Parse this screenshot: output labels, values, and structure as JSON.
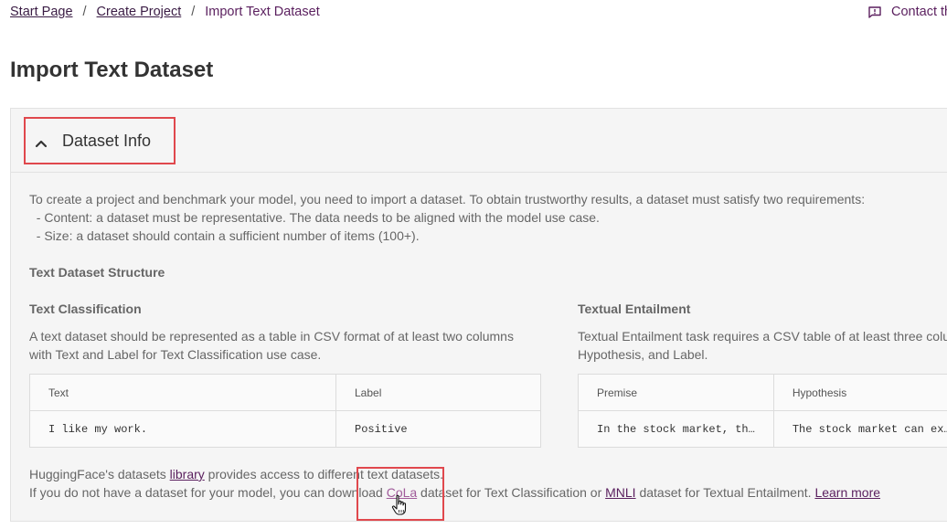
{
  "breadcrumb": {
    "start": "Start Page",
    "separator": "/",
    "create": "Create Project",
    "current": "Import Text Dataset"
  },
  "contact": {
    "label": "Contact th",
    "icon": "feedback-icon"
  },
  "page_title": "Import Text Dataset",
  "panel": {
    "title": "Dataset Info",
    "intro_line1": "To create a project and benchmark your model, you need to import a dataset. To obtain trustworthy results, a dataset must satisfy two requirements:",
    "intro_line2": "  - Content: a dataset must be representative. The data needs to be aligned with the model use case.",
    "intro_line3": "  - Size: a dataset should contain a sufficient number of items (100+).",
    "structure_heading": "Text Dataset Structure",
    "classification": {
      "heading": "Text Classification",
      "desc_line1": "A text dataset should be represented as a table in CSV format of at least two columns",
      "desc_line2": "with Text and Label for Text Classification use case.",
      "table_headers": [
        "Text",
        "Label"
      ],
      "table_row": [
        "I like my work.",
        "Positive"
      ]
    },
    "entailment": {
      "heading": "Textual Entailment",
      "desc_line1": "Textual Entailment task requires a CSV table of at least three colu",
      "desc_line2": "Hypothesis, and Label.",
      "table_headers": [
        "Premise",
        "Hypothesis"
      ],
      "table_row": [
        "In the stock market, th…",
        "The stock market can ex…"
      ]
    },
    "footer": {
      "line1_pre": "HuggingFace's datasets ",
      "line1_link": "library",
      "line1_post": " provides access to different text datasets.",
      "line2_pre": "If you do not have a dataset for your model, you can download ",
      "line2_link1": "CoLa",
      "line2_mid": " dataset for Text Classification or ",
      "line2_link2": "MNLI",
      "line2_post": " dataset for Textual Entailment. ",
      "line2_link3": "Learn more"
    }
  },
  "colors": {
    "accent": "#5a1f5e",
    "highlight": "#e0484d",
    "panel_bg": "#f5f5f5"
  }
}
